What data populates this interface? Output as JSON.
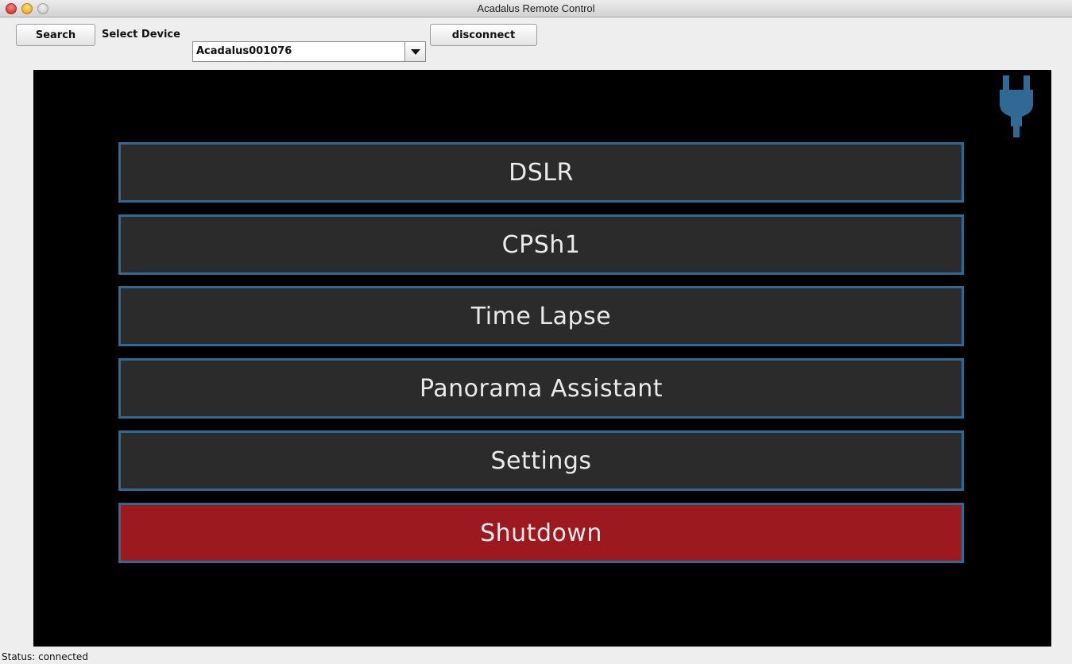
{
  "window": {
    "title": "Acadalus Remote Control"
  },
  "toolbar": {
    "search_label": "Search",
    "device_label": "Select Device",
    "device_value": "Acadalus001076",
    "disconnect_label": "disconnect"
  },
  "menu": {
    "items": [
      {
        "label": "DSLR"
      },
      {
        "label": "CPSh1"
      },
      {
        "label": "Time Lapse"
      },
      {
        "label": "Panorama Assistant"
      },
      {
        "label": "Settings"
      },
      {
        "label": "Shutdown"
      }
    ]
  },
  "status": {
    "text": "Status: connected"
  },
  "colors": {
    "panel_bg": "#000000",
    "button_bg": "#2b2b2b",
    "button_border": "#2e6a93",
    "shutdown_bg": "#9c1a1f",
    "plug_icon": "#2e6a93"
  },
  "icons": {
    "connection": "plug-icon"
  }
}
